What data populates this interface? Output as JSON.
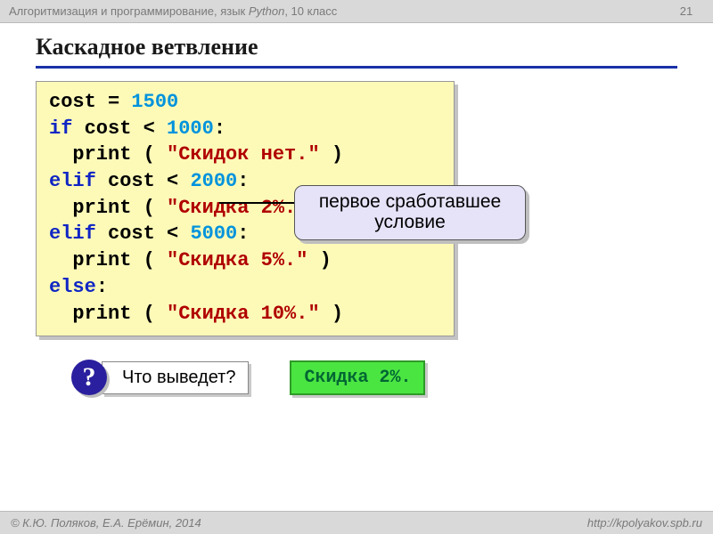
{
  "header": {
    "course_prefix": "Алгоритмизация и программирование, язык ",
    "course_em": "Python",
    "course_suffix": ", 10 класс",
    "page_number": "21"
  },
  "title": "Каскадное ветвление",
  "code": {
    "l1_a": "cost = ",
    "l1_num": "1500",
    "l2_kw": "if",
    "l2_a": " cost < ",
    "l2_num": "1000",
    "l2_b": ":",
    "l3_a": "  print ( ",
    "l3_str": "\"Скидок нет.\"",
    "l3_b": " )",
    "l4_kw": "elif",
    "l4_a": " cost < ",
    "l4_num": "2000",
    "l4_b": ":",
    "l5_a": "  print ( ",
    "l5_str": "\"Скидка 2%.\"",
    "l5_b": " )",
    "l6_kw": "elif",
    "l6_a": " cost < ",
    "l6_num": "5000",
    "l6_b": ":",
    "l7_a": "  print ( ",
    "l7_str": "\"Скидка 5%.\"",
    "l7_b": " )",
    "l8_kw": "else",
    "l8_a": ":",
    "l9_a": "  print ( ",
    "l9_str": "\"Скидка 10%.\"",
    "l9_b": " )"
  },
  "callout": {
    "line1": "первое сработавшее",
    "line2": "условие"
  },
  "question": {
    "mark": "?",
    "text": "Что выведет?"
  },
  "answer": "Скидка 2%.",
  "footer": {
    "authors": "© К.Ю. Поляков, Е.А. Ерёмин, 2014",
    "url": "http://kpolyakov.spb.ru"
  }
}
